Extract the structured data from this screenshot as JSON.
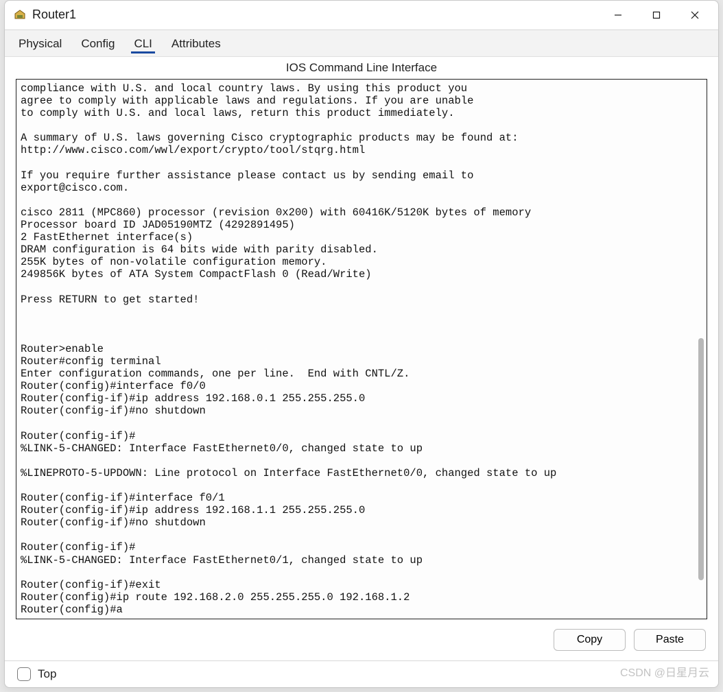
{
  "window": {
    "title": "Router1"
  },
  "tabs": [
    {
      "label": "Physical",
      "active": false
    },
    {
      "label": "Config",
      "active": false
    },
    {
      "label": "CLI",
      "active": true
    },
    {
      "label": "Attributes",
      "active": false
    }
  ],
  "subtitle": "IOS Command Line Interface",
  "cli_text": "compliance with U.S. and local country laws. By using this product you\nagree to comply with applicable laws and regulations. If you are unable\nto comply with U.S. and local laws, return this product immediately.\n\nA summary of U.S. laws governing Cisco cryptographic products may be found at:\nhttp://www.cisco.com/wwl/export/crypto/tool/stqrg.html\n\nIf you require further assistance please contact us by sending email to\nexport@cisco.com.\n\ncisco 2811 (MPC860) processor (revision 0x200) with 60416K/5120K bytes of memory\nProcessor board ID JAD05190MTZ (4292891495)\n2 FastEthernet interface(s)\nDRAM configuration is 64 bits wide with parity disabled.\n255K bytes of non-volatile configuration memory.\n249856K bytes of ATA System CompactFlash 0 (Read/Write)\n\nPress RETURN to get started!\n\n\n\nRouter>enable\nRouter#config terminal\nEnter configuration commands, one per line.  End with CNTL/Z.\nRouter(config)#interface f0/0\nRouter(config-if)#ip address 192.168.0.1 255.255.255.0\nRouter(config-if)#no shutdown\n\nRouter(config-if)#\n%LINK-5-CHANGED: Interface FastEthernet0/0, changed state to up\n\n%LINEPROTO-5-UPDOWN: Line protocol on Interface FastEthernet0/0, changed state to up\n\nRouter(config-if)#interface f0/1\nRouter(config-if)#ip address 192.168.1.1 255.255.255.0\nRouter(config-if)#no shutdown\n\nRouter(config-if)#\n%LINK-5-CHANGED: Interface FastEthernet0/1, changed state to up\n\nRouter(config-if)#exit\nRouter(config)#ip route 192.168.2.0 255.255.255.0 192.168.1.2\nRouter(config)#a",
  "buttons": {
    "copy": "Copy",
    "paste": "Paste"
  },
  "footer": {
    "top_label": "Top",
    "top_checked": false
  },
  "watermark": "CSDN @日星月云"
}
